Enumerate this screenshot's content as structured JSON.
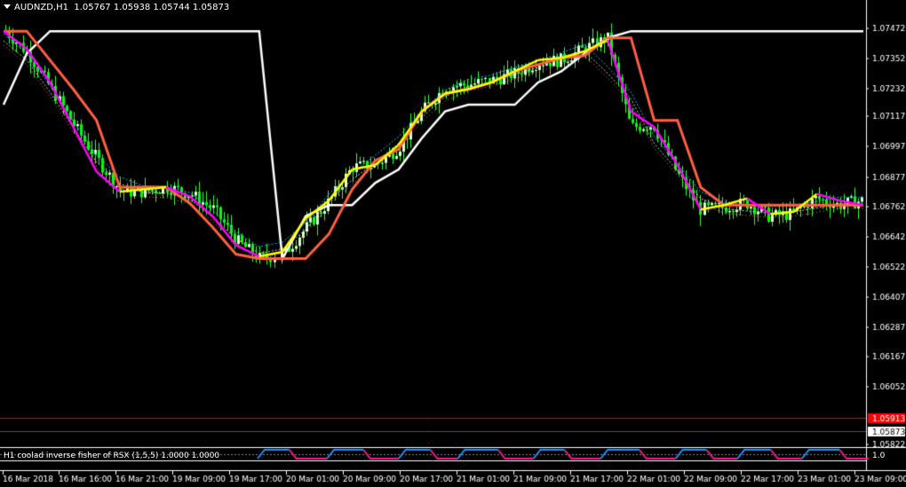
{
  "header": {
    "symbol": "AUDNZD,H1",
    "ohlc": "1.05767 1.05938 1.05744 1.05873"
  },
  "indicator": {
    "label": "H1 coolad inverse fisher of RSX (1,5,5) 1.0000 1.0000",
    "value": "1.0"
  },
  "price_axis": {
    "ticks": [
      "1.07472",
      "1.07352",
      "1.07232",
      "1.07117",
      "1.06997",
      "1.06877",
      "1.06762",
      "1.06642",
      "1.06522",
      "1.06407",
      "1.06287",
      "1.06167",
      "1.06052",
      "1.05822"
    ],
    "bid_label": "1.05913",
    "ask_label": "1.05873"
  },
  "time_axis": {
    "ticks": [
      "16 Mar 2018",
      "16 Mar 16:00",
      "16 Mar 21:00",
      "19 Mar 09:00",
      "19 Mar 17:00",
      "20 Mar 01:00",
      "20 Mar 09:00",
      "20 Mar 17:00",
      "21 Mar 01:00",
      "21 Mar 09:00",
      "21 Mar 17:00",
      "22 Mar 01:00",
      "22 Mar 09:00",
      "22 Mar 17:00",
      "23 Mar 01:00",
      "23 Mar 09:00"
    ]
  },
  "colors": {
    "background": "#000000",
    "bull_candle": "#ffffff",
    "bear_candle": "#00ff00",
    "wick": "#33ff33",
    "candle_fill": "#ddffdd",
    "ma_white": "#ffffff",
    "ma_orange": "#ff6040",
    "ma_magenta": "#ff00ff",
    "ma_yellow": "#ffff00",
    "ma_dotted_white": "#cccccc",
    "ma_dotted_cyan": "#00bfff",
    "ma_dotted_orange": "#ff8c00",
    "bid_line": "#ff0000",
    "ask_line": "#555555",
    "ind_blue": "#1e90ff",
    "ind_pink": "#ff1493"
  },
  "chart_data": {
    "type": "candlestick",
    "title": "AUDNZD,H1",
    "ylim": [
      1.0575,
      1.0758
    ],
    "x": [
      "16 Mar 2018",
      "16 Mar 16:00",
      "16 Mar 21:00",
      "19 Mar 09:00",
      "19 Mar 17:00",
      "20 Mar 01:00",
      "20 Mar 09:00",
      "20 Mar 17:00",
      "21 Mar 01:00",
      "21 Mar 09:00",
      "21 Mar 17:00",
      "22 Mar 01:00",
      "22 Mar 09:00",
      "22 Mar 17:00",
      "23 Mar 01:00",
      "23 Mar 09:00"
    ],
    "close_path": [
      1.0748,
      1.0738,
      1.0722,
      1.0705,
      1.069,
      1.0676,
      1.0676,
      1.0678,
      1.0675,
      1.0668,
      1.0654,
      1.0646,
      1.0648,
      1.066,
      1.0672,
      1.0687,
      1.0688,
      1.0696,
      1.0712,
      1.0723,
      1.0724,
      1.0726,
      1.0729,
      1.0734,
      1.0735,
      1.074,
      1.0745,
      1.0705,
      1.0706,
      1.0685,
      1.0668,
      1.0669,
      1.0671,
      1.0665,
      1.0666,
      1.0673,
      1.067,
      1.0672
    ],
    "series": [
      {
        "name": "",
        "color": "#ffff00",
        "values": [
          1.0748,
          1.074,
          1.0725,
          1.0705,
          1.0685,
          1.0676,
          1.0677,
          1.0678,
          1.0674,
          1.0665,
          1.0652,
          1.0647,
          1.0649,
          1.0664,
          1.0672,
          1.0686,
          1.0688,
          1.0697,
          1.0712,
          1.072,
          1.0722,
          1.0725,
          1.073,
          1.0735,
          1.0736,
          1.0739,
          1.0744,
          1.0712,
          1.0705,
          1.0688,
          1.0668,
          1.067,
          1.0673,
          1.0666,
          1.0667,
          1.0675,
          1.0672,
          1.067
        ]
      },
      {
        "name": "",
        "color": "#ff6040",
        "values": [
          1.0748,
          1.0748,
          1.0735,
          1.0722,
          1.0708,
          1.0678,
          1.0678,
          1.0678,
          1.0671,
          1.066,
          1.0648,
          1.0646,
          1.0646,
          1.0646,
          1.0657,
          1.0677,
          1.069,
          1.0695,
          1.0712,
          1.072,
          1.0722,
          1.0725,
          1.073,
          1.0733,
          1.0736,
          1.0737,
          1.0745,
          1.0745,
          1.0708,
          1.0708,
          1.0678,
          1.067,
          1.067,
          1.067,
          1.067,
          1.067,
          1.067,
          1.067
        ]
      },
      {
        "name": "",
        "color": "#ffffff",
        "values": [
          1.0715,
          1.0738,
          1.0748,
          1.0748,
          1.0748,
          1.0748,
          1.0748,
          1.0748,
          1.0748,
          1.0748,
          1.0748,
          1.0748,
          1.0646,
          1.0665,
          1.067,
          1.067,
          1.068,
          1.0686,
          1.07,
          1.0712,
          1.0715,
          1.0715,
          1.0715,
          1.0725,
          1.073,
          1.0738,
          1.0745,
          1.0748,
          1.0748,
          1.0748,
          1.0748,
          1.0748,
          1.0748,
          1.0748,
          1.0748,
          1.0748,
          1.0748,
          1.0748
        ]
      }
    ]
  }
}
